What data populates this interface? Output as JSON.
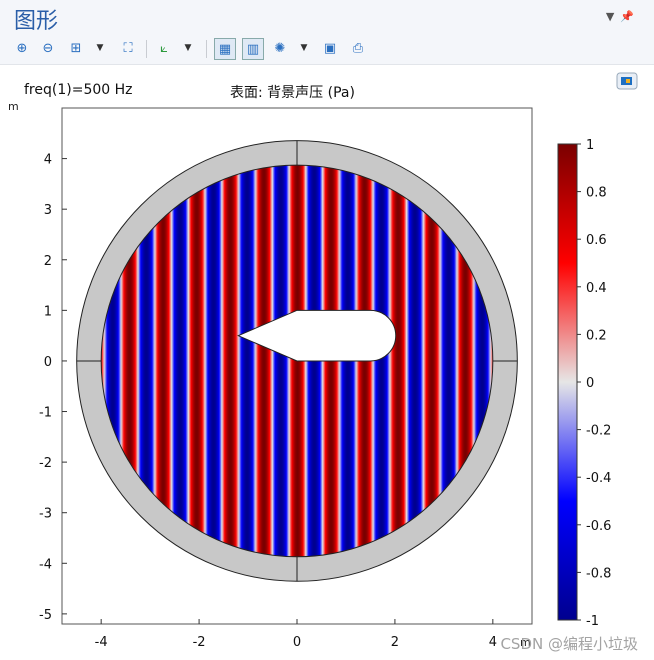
{
  "window": {
    "title": "图形"
  },
  "toolbar": {
    "icons": [
      "zoom-in-icon",
      "zoom-out-icon",
      "zoom-box-icon",
      "zoom-extents-icon",
      "axes-orientation-icon",
      "grid-icon",
      "color-legend-icon",
      "scene-light-icon",
      "camera-icon",
      "print-icon"
    ]
  },
  "plot": {
    "left_label": "freq(1)=500 Hz",
    "center_label": "表面: 背景声压 (Pa)",
    "y_unit": "m",
    "x_unit": "m"
  },
  "chart_data": {
    "type": "heatmap",
    "title": "表面: 背景声压 (Pa)",
    "xlim": [
      -4.8,
      4.8
    ],
    "ylim": [
      -5.2,
      5.0
    ],
    "xticks": [
      -4,
      -2,
      0,
      2,
      4
    ],
    "yticks": [
      -5,
      -4,
      -3,
      -2,
      -1,
      0,
      1,
      2,
      3,
      4
    ],
    "inner_radius": 4,
    "outer_radius": 4.5,
    "colorbar": {
      "min": -1,
      "max": 1,
      "ticks": [
        "1",
        "0.8",
        "0.6",
        "0.4",
        "0.2",
        "0",
        "-0.2",
        "-0.4",
        "-0.6",
        "-0.8",
        "-1"
      ]
    },
    "colors": {
      "low": "#00008f",
      "mid": "#e6e6e6",
      "high": "#7a0000",
      "pml": "#c8c8c8"
    }
  },
  "watermark": "CSDN @编程小垃圾"
}
